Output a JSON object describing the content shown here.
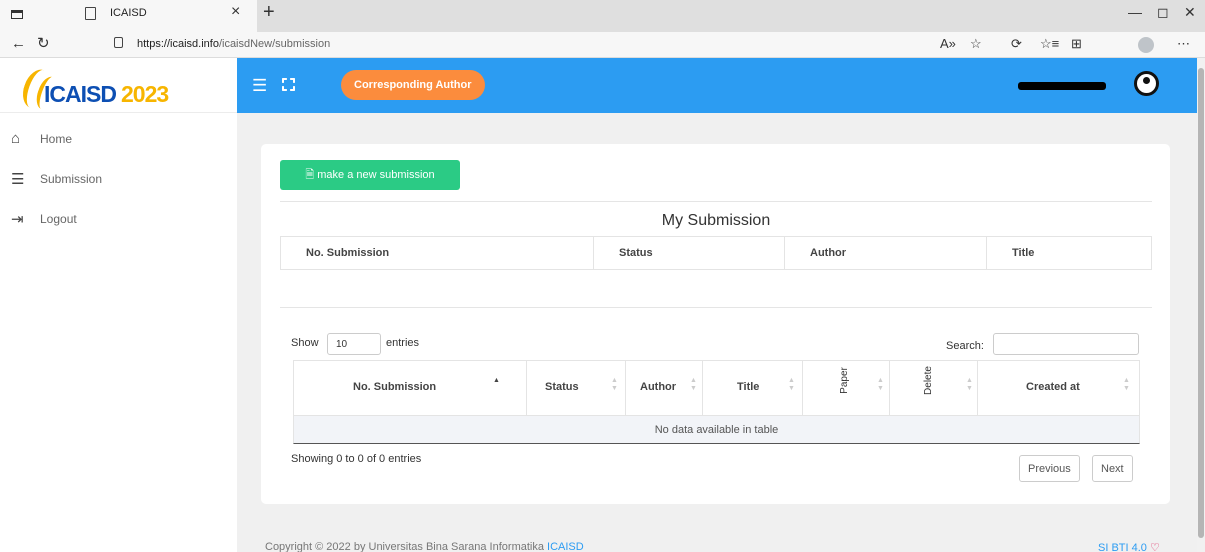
{
  "browser": {
    "tab_title": "ICAISD",
    "tab_close": "×",
    "new_tab": "+",
    "url_domain": "https://icaisd.info",
    "url_path": "/icaisdNew/submission",
    "win_min": "—",
    "win_restore": "◻",
    "win_close": "✕",
    "back": "←",
    "reload": "↻",
    "toolbar_icons": [
      "A»",
      "☆",
      "⟳",
      "☆≡",
      "⊞",
      "⋯"
    ]
  },
  "sidebar": {
    "logo_text": "ICAISD",
    "logo_year": "2023",
    "items": [
      {
        "label": "Home",
        "icon": "⌂"
      },
      {
        "label": "Submission",
        "icon": "☰"
      },
      {
        "label": "Logout",
        "icon": "⇥"
      }
    ]
  },
  "header": {
    "menu_icon": "☰",
    "role_label": "Corresponding Author"
  },
  "main": {
    "new_button": "🗎 make a new submission",
    "section_title": "My Submission",
    "summary_table": {
      "columns": [
        "No. Submission",
        "Status",
        "Author",
        "Title"
      ]
    },
    "datatable": {
      "show_label": "Show",
      "page_size": "10",
      "entries_label": "entries",
      "search_label": "Search:",
      "search_value": "",
      "columns": [
        "No. Submission",
        "Status",
        "Author",
        "Title",
        "Paper",
        "Delete",
        "Created at"
      ],
      "empty_message": "No data available in table",
      "info": "Showing 0 to 0 of 0 entries",
      "prev_label": "Previous",
      "next_label": "Next"
    }
  },
  "footer": {
    "copyright": "Copyright © 2022 by Universitas Bina Sarana Informatika ",
    "link": "ICAISD",
    "version": "SI BTI 4.0"
  },
  "colors": {
    "header": "#2c9cf2",
    "role_button": "#fb8c3d",
    "new_button": "#2bcb85",
    "logo_blue": "#0d4fb3",
    "logo_gold": "#f7b500"
  }
}
